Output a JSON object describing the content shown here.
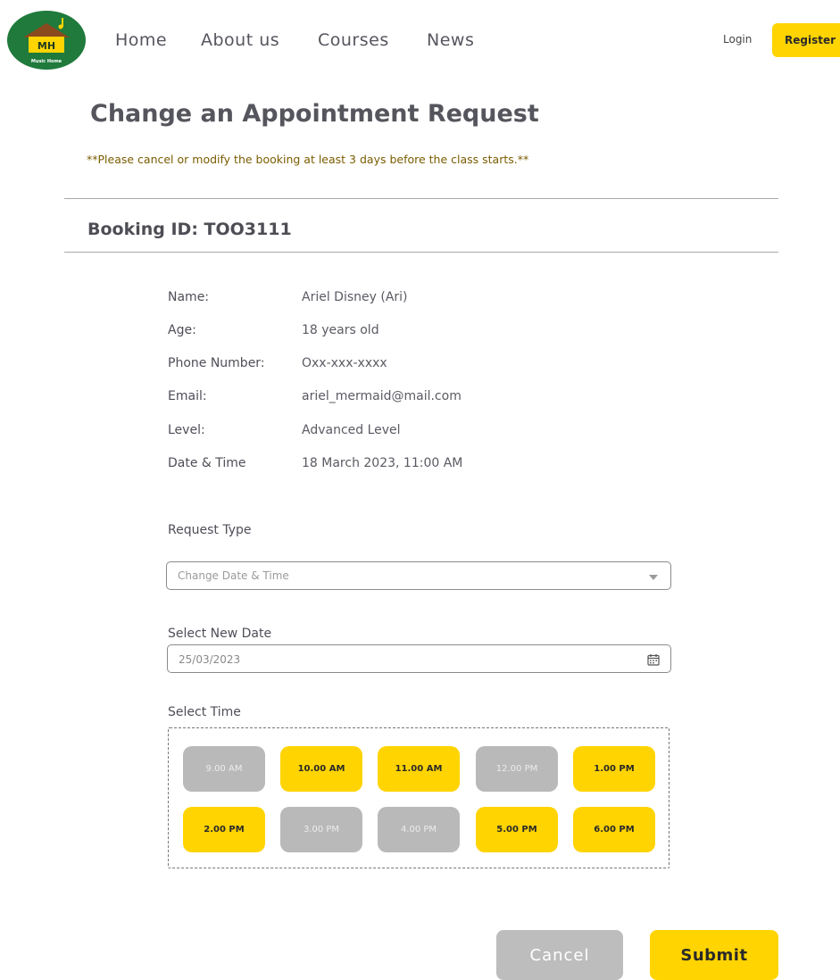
{
  "header": {
    "logo_text": "MH",
    "logo_subtext": "Music Home",
    "nav": [
      "Home",
      "About us",
      "Courses",
      "News"
    ],
    "login": "Login",
    "register": "Register"
  },
  "page": {
    "title": "Change an Appointment Request",
    "notice": "**Please cancel or modify the booking at least 3 days before the class starts.**",
    "booking_id": "Booking ID: TOO3111"
  },
  "details": [
    {
      "label": "Name:",
      "value": "Ariel Disney (Ari)"
    },
    {
      "label": "Age:",
      "value": "18 years old"
    },
    {
      "label": "Phone Number:",
      "value": "Oxx-xxx-xxxx"
    },
    {
      "label": "Email:",
      "value": "ariel_mermaid@mail.com"
    },
    {
      "label": "Level:",
      "value": "Advanced Level"
    },
    {
      "label": "Date & Time",
      "value": "18 March 2023, 11:00 AM"
    }
  ],
  "form": {
    "request_type_label": "Request Type",
    "request_type_value": "Change Date & Time",
    "new_date_label": "Select New Date",
    "new_date_value": "25/03/2023",
    "time_label": "Select Time",
    "times": [
      {
        "label": "9.00 AM",
        "available": false
      },
      {
        "label": "10.00 AM",
        "available": true
      },
      {
        "label": "11.00 AM",
        "available": true
      },
      {
        "label": "12.00 PM",
        "available": false
      },
      {
        "label": "1.00 PM",
        "available": true
      },
      {
        "label": "2.00 PM",
        "available": true
      },
      {
        "label": "3.00 PM",
        "available": false
      },
      {
        "label": "4.00 PM",
        "available": false
      },
      {
        "label": "5.00 PM",
        "available": true
      },
      {
        "label": "6.00 PM",
        "available": true
      }
    ]
  },
  "actions": {
    "cancel": "Cancel",
    "submit": "Submit"
  },
  "colors": {
    "accent": "#ffd400",
    "disabled": "#b9b9b9",
    "logo_green": "#1f7a3c",
    "notice": "#7a5c00"
  }
}
